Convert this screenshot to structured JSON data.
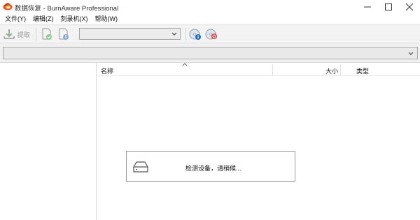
{
  "window": {
    "title": "数据恢复 - BurnAware Professional",
    "controls": [
      "minimize",
      "maximize",
      "close"
    ]
  },
  "menu": {
    "items": [
      "文件(Y)",
      "编辑(Z)",
      "刻录机(X)",
      "帮助(W)"
    ]
  },
  "toolbar": {
    "extract_label": "提取",
    "device_select_value": "",
    "icons": [
      "extract-icon",
      "verify-file-icon",
      "file-properties-icon",
      "disc-info-icon",
      "disc-eject-icon"
    ]
  },
  "path": {
    "value": ""
  },
  "file_list": {
    "columns": [
      "名称",
      "大小",
      "类型"
    ],
    "sort_column": "名称",
    "rows": []
  },
  "status_dialog": {
    "message": "检测设备，请稍候..."
  },
  "colors": {
    "toolbar_bg": "#f3f3f3",
    "accent_blue": "#1e6ec8",
    "accent_green": "#3aa83a",
    "accent_red": "#d23c3c"
  }
}
